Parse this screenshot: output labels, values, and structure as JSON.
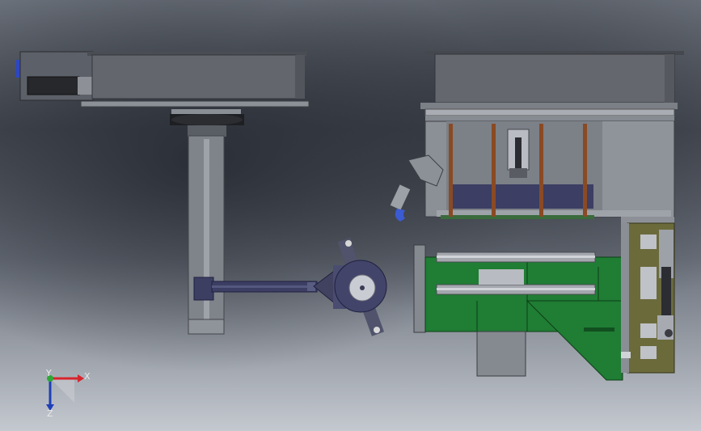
{
  "triad": {
    "x_label": "X",
    "y_label": "Y",
    "z_label": "Z",
    "x_color": "#d8242c",
    "y_color": "#2ea836",
    "z_color": "#1d3fb8"
  },
  "colors": {
    "steel_dark": "#55595f",
    "steel_mid": "#8b8f96",
    "steel_light": "#a7abb1",
    "panel_green": "#1f7d34",
    "panel_olive": "#6b6a3b",
    "purple_bar": "#3c3e63",
    "copper_rod": "#8a4a24",
    "accent_blue": "#2b47c8"
  }
}
